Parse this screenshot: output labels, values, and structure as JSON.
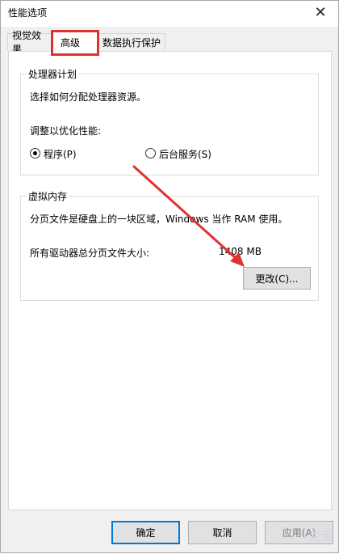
{
  "window": {
    "title": "性能选项",
    "close_glyph": "✕"
  },
  "tabs": [
    {
      "label": "视觉效果"
    },
    {
      "label": "高级"
    },
    {
      "label": "数据执行保护"
    }
  ],
  "processor_group": {
    "legend": "处理器计划",
    "description": "选择如何分配处理器资源。",
    "adjust_label": "调整以优化性能:",
    "options": [
      {
        "label": "程序(P)",
        "selected": true
      },
      {
        "label": "后台服务(S)",
        "selected": false
      }
    ]
  },
  "vmem_group": {
    "legend": "虚拟内存",
    "description": "分页文件是硬盘上的一块区域，Windows 当作 RAM 使用。",
    "size_label": "所有驱动器总分页文件大小:",
    "size_value": "1408 MB",
    "change_button": "更改(C)..."
  },
  "footer": {
    "ok": "确定",
    "cancel": "取消",
    "apply": "应用(A)"
  },
  "annotation_color": "#e03131",
  "watermark": {
    "text": "生活"
  }
}
